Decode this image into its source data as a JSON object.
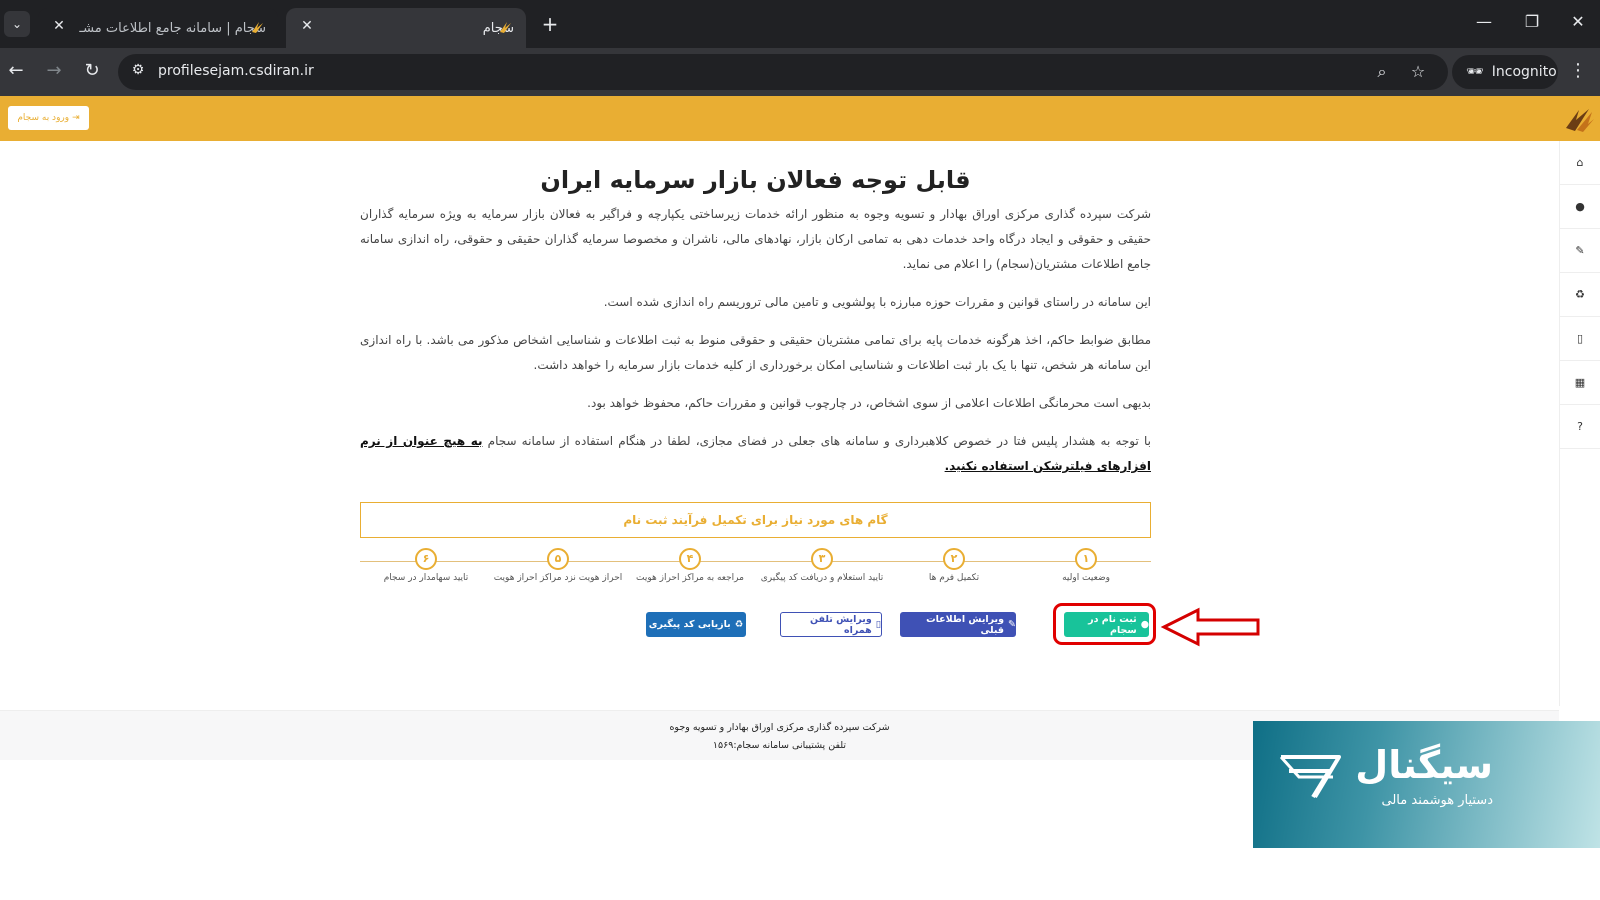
{
  "browser": {
    "tabs": [
      {
        "title": "سجام | سامانه جامع اطلاعات مشـ",
        "active": false
      },
      {
        "title": "سجام",
        "active": true
      }
    ],
    "url": "profilesejam.csdiran.ir",
    "incognito_label": "Incognito"
  },
  "site": {
    "brand_color": "#e9ae33",
    "login_label": "ورود به سجام",
    "headline": "قابل توجه فعالان بازار سرمایه ایران",
    "paragraphs": [
      "شرکت سپرده گذاری مرکزی اوراق بهادار و تسویه وجوه به منظور ارائه خدمات زیرساختی یکپارچه و فراگیر به فعالان بازار سرمایه به ویژه سرمایه گذاران حقیقی و حقوقی و ایجاد درگاه واحد خدمات دهی به تمامی ارکان بازار، نهادهای مالی، ناشران و مخصوصا سرمایه گذاران حقیقی و حقوقی، راه اندازی سامانه جامع اطلاعات مشتریان(سجام) را اعلام می نماید.",
      "این سامانه در راستای قوانین و مقررات حوزه مبارزه با پولشویی و تامین مالی تروریسم راه اندازی شده است.",
      "مطابق ضوابط حاکم، اخذ هرگونه خدمات پایه برای تمامی مشتریان حقیقی و حقوقی منوط به ثبت اطلاعات و شناسایی اشخاص مذکور می باشد. با راه اندازی این سامانه هر شخص، تنها با یک بار ثبت اطلاعات و شناسایی امکان برخورداری از کلیه خدمات بازار سرمایه را خواهد داشت.",
      "بدیهی است محرمانگی اطلاعات اعلامی از سوی اشخاص، در چارچوب قوانین و مقررات حاکم، محفوظ خواهد بود."
    ],
    "warning_text": "با توجه به هشدار پلیس فتا در خصوص کلاهبرداری و سامانه های جعلی در فضای مجازی، لطفا در هنگام استفاده از سامانه سجام ",
    "warning_strong": "به هیچ عنوان از نرم افزارهای فیلترشکن استفاده نکنید.",
    "steps_title": "گام های مورد نیاز برای تکمیل فرآیند ثبت نام",
    "steps": [
      {
        "num": "۱",
        "label": "وضعیت اولیه"
      },
      {
        "num": "۲",
        "label": "تکمیل فرم ها"
      },
      {
        "num": "۳",
        "label": "تایید استعلام و دریافت کد پیگیری"
      },
      {
        "num": "۴",
        "label": "مراجعه به مراکز احراز هویت"
      },
      {
        "num": "۵",
        "label": "احراز هویت نزد مراکز احراز هویت"
      },
      {
        "num": "۶",
        "label": "تایید سهامدار در سجام"
      }
    ],
    "buttons": {
      "register": "ثبت نام در سجام",
      "edit_info": "ویرایش اطلاعات قبلی",
      "edit_phone": "ویرایش تلفن همراه",
      "track_code": "بازیابی کد پیگیری"
    },
    "footer": {
      "line1": "شرکت سپرده گذاری مرکزی اوراق بهادار و تسویه وجوه",
      "line2": "تلفن پشتیبانی سامانه سجام:۱۵۶۹"
    }
  },
  "watermark": {
    "name": "سیگنال",
    "subtitle": "دستیار هوشمند مالی"
  },
  "side_icons": [
    "home-icon",
    "user-icon",
    "edit-icon",
    "refresh-icon",
    "mobile-icon",
    "calculator-icon",
    "help-icon"
  ]
}
